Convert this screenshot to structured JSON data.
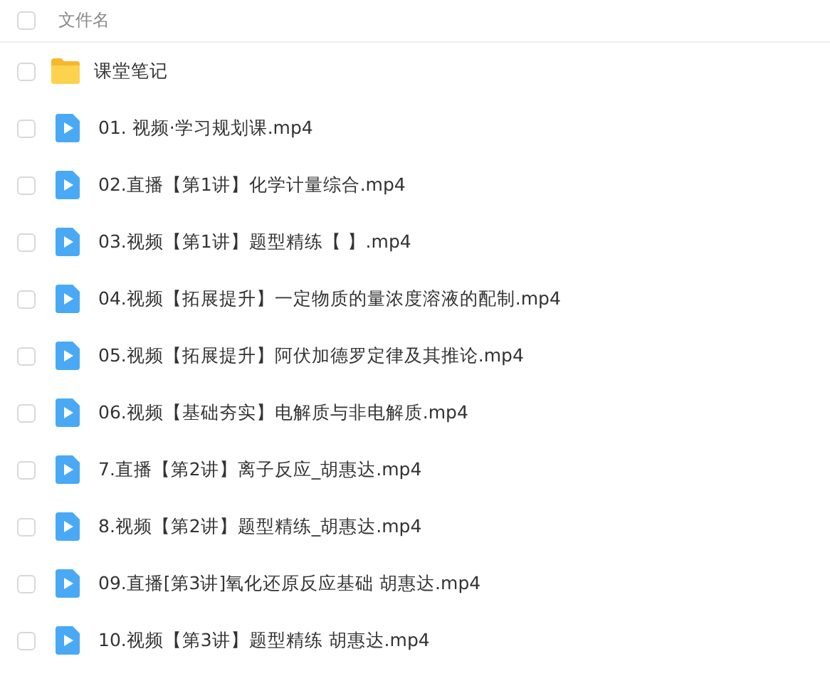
{
  "header": {
    "checked": false,
    "label": "文件名"
  },
  "files": [
    {
      "kind": "folder",
      "name": "课堂笔记",
      "checked": false
    },
    {
      "kind": "video",
      "name": "01. 视频·学习规划课.mp4",
      "checked": false
    },
    {
      "kind": "video",
      "name": "02.直播【第1讲】化学计量综合.mp4",
      "checked": false
    },
    {
      "kind": "video",
      "name": "03.视频【第1讲】题型精练【 】.mp4",
      "checked": false
    },
    {
      "kind": "video",
      "name": "04.视频【拓展提升】一定物质的量浓度溶液的配制.mp4",
      "checked": false
    },
    {
      "kind": "video",
      "name": "05.视频【拓展提升】阿伏加德罗定律及其推论.mp4",
      "checked": false
    },
    {
      "kind": "video",
      "name": "06.视频【基础夯实】电解质与非电解质.mp4",
      "checked": false
    },
    {
      "kind": "video",
      "name": "7.直播【第2讲】离子反应_胡惠达.mp4",
      "checked": false
    },
    {
      "kind": "video",
      "name": "8.视频【第2讲】题型精练_胡惠达.mp4",
      "checked": false
    },
    {
      "kind": "video",
      "name": "09.直播[第3讲]氧化还原反应基础 胡惠达.mp4",
      "checked": false
    },
    {
      "kind": "video",
      "name": "10.视频【第3讲】题型精练 胡惠达.mp4",
      "checked": false
    }
  ]
}
